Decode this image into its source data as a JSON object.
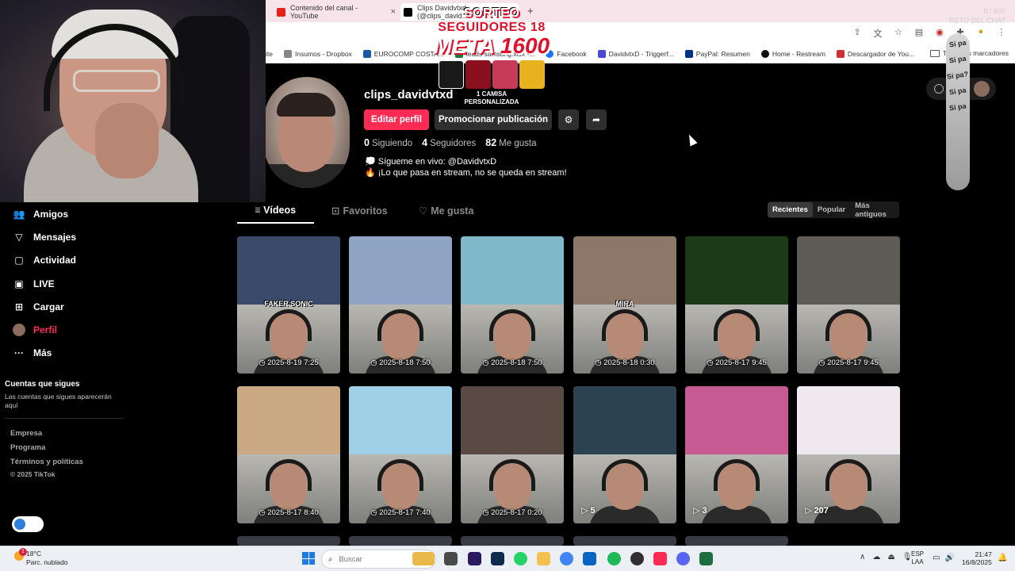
{
  "browser": {
    "tabs": [
      {
        "title": "Contenido del canal - YouTube",
        "color": "#e62117"
      },
      {
        "title": "Clips Davidvtxd (@clips_david...",
        "color": "#000000"
      }
    ],
    "bookmarks": [
      {
        "label": "ite",
        "color": "#7b7b7b"
      },
      {
        "label": "Insumos - Dropbox",
        "color": "#888888"
      },
      {
        "label": "EUROCOMP COSTA...",
        "color": "#1a5aa5"
      },
      {
        "label": "leads samsung.xlsx -...",
        "color": "#1d7a3d"
      },
      {
        "label": "Facebook",
        "color": "#1877f2"
      },
      {
        "label": "DavidvtxD - Triggerf...",
        "color": "#4a4ad0"
      },
      {
        "label": "PayPal: Resumen",
        "color": "#003087"
      },
      {
        "label": "Home - Restream",
        "color": "#111111"
      },
      {
        "label": "Descargador de You...",
        "color": "#d32f2f"
      }
    ],
    "bookmarks_more": "»",
    "all_bookmarks": "Todos los marcadores"
  },
  "overlay": {
    "giveaway_line1_white": "SORTEO",
    "giveaway_line1_red": "SEGUIDORES 18",
    "giveaway_meta": "META",
    "giveaway_number": "1600",
    "giveaway_prize_1": "1 CAMISA",
    "giveaway_prize_2": "PERSONALIZADA",
    "chat_top_1": "0 / 600",
    "chat_top_2": "RETO DEL CHAT",
    "chat_pill": [
      "Si pa",
      "Si pa",
      "Si pa?",
      "Si pa",
      "Si pa"
    ]
  },
  "nav": {
    "items": [
      {
        "label": "Amigos",
        "icon": "friends-icon",
        "glyph": "👥"
      },
      {
        "label": "Mensajes",
        "icon": "messages-icon",
        "glyph": "▽"
      },
      {
        "label": "Actividad",
        "icon": "activity-icon",
        "glyph": "▢"
      },
      {
        "label": "LIVE",
        "icon": "live-icon",
        "glyph": "▣"
      },
      {
        "label": "Cargar",
        "icon": "upload-icon",
        "glyph": "⊞"
      },
      {
        "label": "Perfil",
        "icon": "profile-avatar-icon",
        "glyph": ""
      },
      {
        "label": "Más",
        "icon": "more-icon",
        "glyph": "···"
      }
    ],
    "following_title": "Cuentas que sigues",
    "following_desc": "Las cuentas que sigues aparecerán aquí",
    "footer": [
      "Empresa",
      "Programa",
      "Términos y políticas",
      "© 2025 TikTok"
    ]
  },
  "profile": {
    "username": "clips_davidvtxd",
    "edit_label": "Editar perfil",
    "promote_label": "Promocionar publicación",
    "stats": [
      {
        "value": "0",
        "label": "Siguiendo"
      },
      {
        "value": "4",
        "label": "Seguidores"
      },
      {
        "value": "82",
        "label": "Me gusta"
      }
    ],
    "bio_1": "💭 Sígueme en vivo: @DavidvtxD",
    "bio_2": "🔥 ¡Lo que pasa en stream, no se queda en stream!"
  },
  "tabs": [
    {
      "label": "Vídeos",
      "glyph": "⦙⦙⦙"
    },
    {
      "label": "Favoritos",
      "glyph": "⊡"
    },
    {
      "label": "Me gusta",
      "glyph": "♡"
    }
  ],
  "sort": [
    "Recientes",
    "Popular",
    "Más antiguos"
  ],
  "videos": [
    {
      "top_color": "#3b4a6a",
      "tag": "FAKER SONIC",
      "caption": "◷ 2025-8-19 7:25",
      "views": ""
    },
    {
      "top_color": "#8fa3c4",
      "tag": "",
      "caption": "◷ 2025-8-18 7:50",
      "views": ""
    },
    {
      "top_color": "#7fb8c8",
      "tag": "",
      "caption": "◷ 2025-8-18 7:50",
      "views": ""
    },
    {
      "top_color": "#8d7768",
      "tag": "MIRA",
      "caption": "◷ 2025-8-18 0:30",
      "views": ""
    },
    {
      "top_color": "#1c3a18",
      "tag": "",
      "caption": "◷ 2025-8-17 9:45",
      "views": ""
    },
    {
      "top_color": "#5e5a55",
      "tag": "",
      "caption": "◷ 2025-8-17 9:45",
      "views": ""
    },
    {
      "top_color": "#c9a883",
      "tag": "",
      "caption": "◷ 2025-8-17 8:40",
      "views": ""
    },
    {
      "top_color": "#9fd0e8",
      "tag": "",
      "caption": "◷ 2025-8-17 7:40",
      "views": ""
    },
    {
      "top_color": "#5a4a44",
      "tag": "",
      "caption": "◷ 2025-8-17 0:20",
      "views": ""
    },
    {
      "top_color": "#2c4250",
      "tag": "",
      "caption": "",
      "views": "▷ 5"
    },
    {
      "top_color": "#c65a92",
      "tag": "",
      "caption": "",
      "views": "▷ 3"
    },
    {
      "top_color": "#efe8ee",
      "tag": "",
      "caption": "",
      "views": "▷ 207"
    }
  ],
  "taskbar": {
    "temp": "18°C",
    "weather": "Parc. nublado",
    "weather_badge": "1",
    "search_label": "Buscar",
    "lang_1": "ESP",
    "lang_2": "LAA",
    "time": "21:47",
    "date": "16/8/2025",
    "apps": [
      {
        "name": "widgets-icon",
        "color": "#e9b949"
      },
      {
        "name": "file-manager-icon",
        "color": "#4a4a4a"
      },
      {
        "name": "premiere-icon",
        "color": "#2a1a5e"
      },
      {
        "name": "photoshop-icon",
        "color": "#0e2a4d"
      },
      {
        "name": "whatsapp-icon",
        "color": "#25d366"
      },
      {
        "name": "folder-icon",
        "color": "#f2c14e"
      },
      {
        "name": "chrome-icon",
        "color": "#4285f4"
      },
      {
        "name": "outlook-icon",
        "color": "#0a64c2"
      },
      {
        "name": "spotify-icon",
        "color": "#1db954"
      },
      {
        "name": "obs-icon",
        "color": "#302e31"
      },
      {
        "name": "tiktok-icon",
        "color": "#fe2c55"
      },
      {
        "name": "discord-icon",
        "color": "#5865f2"
      },
      {
        "name": "excel-icon",
        "color": "#1d6f42"
      }
    ]
  }
}
